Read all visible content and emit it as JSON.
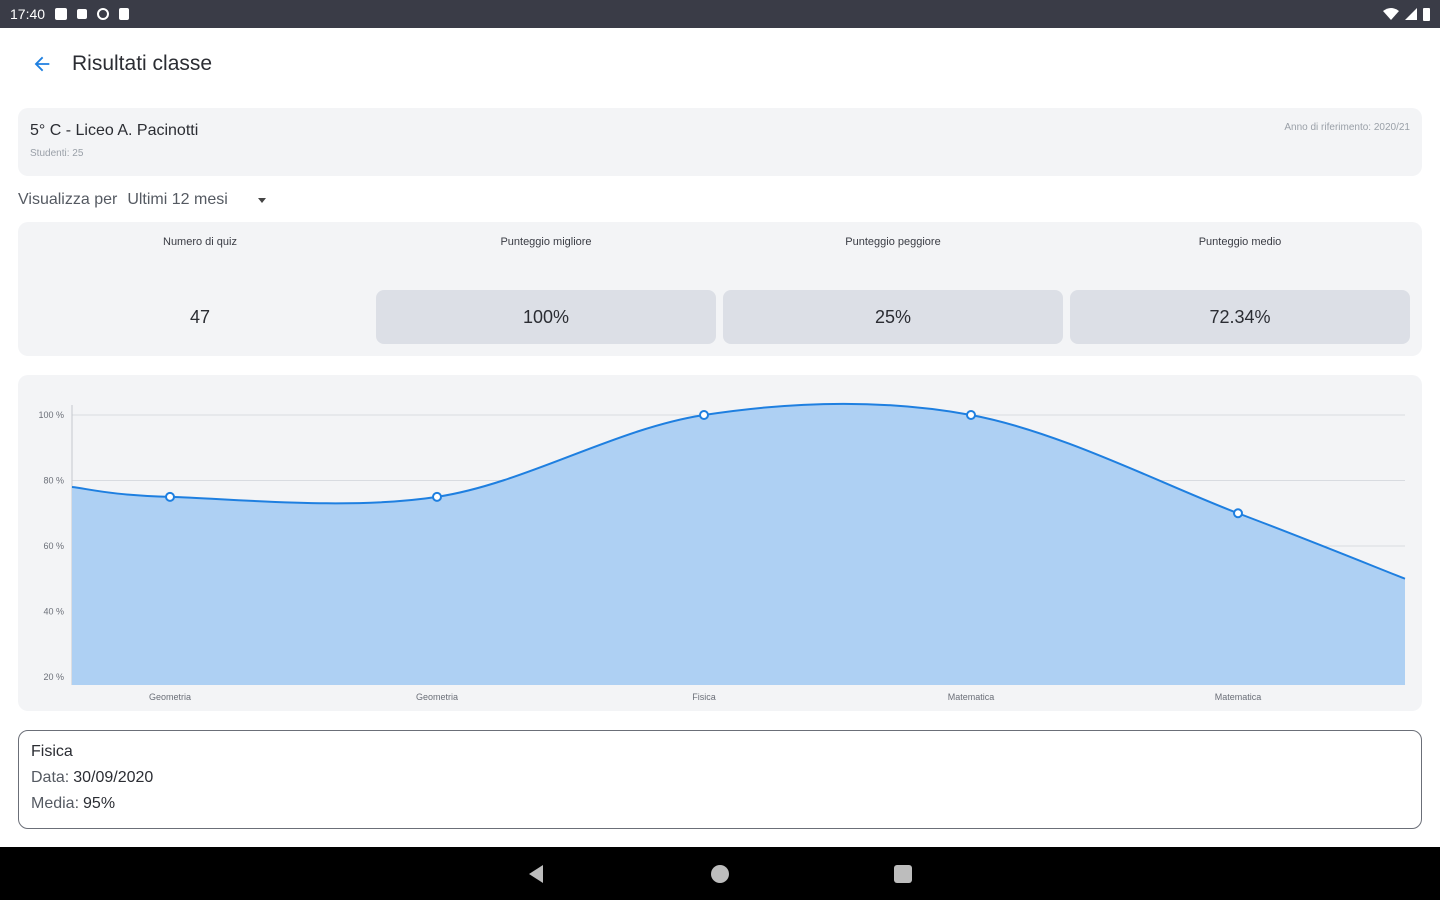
{
  "status_bar": {
    "time": "17:40",
    "icons": [
      "notification-icon",
      "signal-icon",
      "vpn-icon",
      "sd-card-icon",
      "wifi-icon",
      "battery-icon"
    ]
  },
  "app_bar": {
    "title": "Risultati classe",
    "back_icon": "arrow-left-icon"
  },
  "class_card": {
    "name": "5° C - Liceo A. Pacinotti",
    "students": "Studenti: 25",
    "year": "Anno di riferimento: 2020/21"
  },
  "filter": {
    "label": "Visualizza per",
    "selected": "Ultimi 12 mesi"
  },
  "stats": [
    {
      "label": "Numero di quiz",
      "value": "47"
    },
    {
      "label": "Punteggio migliore",
      "value": "100%"
    },
    {
      "label": "Punteggio peggiore",
      "value": "25%"
    },
    {
      "label": "Punteggio medio",
      "value": "72.34%"
    }
  ],
  "chart_data": {
    "type": "area",
    "categories": [
      "Geometria",
      "Geometria",
      "Fisica",
      "Matematica",
      "Matematica"
    ],
    "values": [
      75,
      75,
      100,
      100,
      70
    ],
    "y_ticks": [
      "100 %",
      "80 %",
      "60 %",
      "40 %",
      "20 %"
    ],
    "ylim": [
      20,
      100
    ],
    "grid": true,
    "colors": {
      "line": "#1e7fe0",
      "fill": "#aed0f3",
      "grid": "#d8dbe0",
      "axis": "#9aa0a8"
    }
  },
  "detail": {
    "title": "Fisica",
    "date_label": "Data:",
    "date_value": "30/09/2020",
    "mean_label": "Media:",
    "mean_value": "95%"
  },
  "colors": {
    "accent": "#1e7fe0",
    "status_bar": "#3a3c47",
    "card_bg": "#f3f4f6",
    "stat_box": "#dcdfe6"
  }
}
